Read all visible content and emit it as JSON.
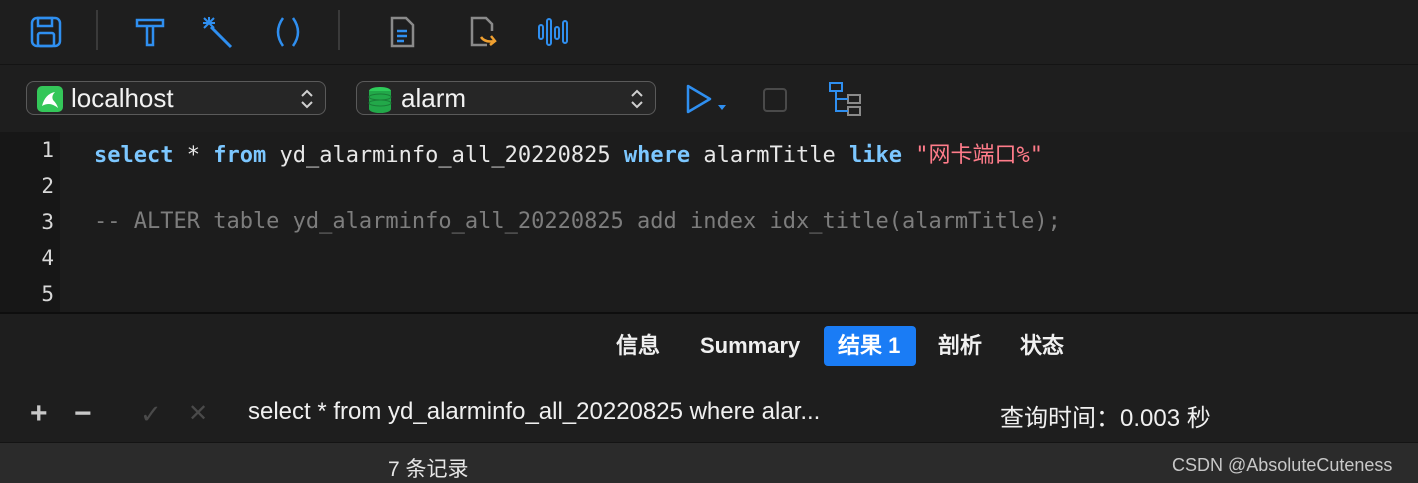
{
  "toolbar": {
    "icons": [
      "save-icon",
      "format-hammer-icon",
      "magic-wand-icon",
      "parentheses-icon",
      "document-icon",
      "export-icon",
      "waveform-icon"
    ]
  },
  "connection": {
    "host": "localhost",
    "database": "alarm"
  },
  "editor": {
    "line_numbers": [
      "1",
      "2",
      "3",
      "4",
      "5"
    ],
    "line1": {
      "kw_select": "select",
      "t1": " * ",
      "kw_from": "from",
      "t2": " yd_alarminfo_all_20220825 ",
      "kw_where": "where",
      "t3": " alarmTitle ",
      "kw_like": "like",
      "t4": " ",
      "str": "\"网卡端口%\""
    },
    "line3_comment": "-- ALTER table yd_alarminfo_all_20220825 add index idx_title(alarmTitle);"
  },
  "tabs": [
    {
      "label": "信息",
      "active": false
    },
    {
      "label": "Summary",
      "active": false
    },
    {
      "label": "结果 1",
      "active": true
    },
    {
      "label": "剖析",
      "active": false
    },
    {
      "label": "状态",
      "active": false
    }
  ],
  "status": {
    "plus": "+",
    "minus": "−",
    "check": "✓",
    "cross": "✕",
    "query_preview": "select * from yd_alarminfo_all_20220825 where alar...",
    "query_time": "查询时间：0.003 秒"
  },
  "footer": {
    "record_count": "7 条记录",
    "watermark": "CSDN @AbsoluteCuteness"
  },
  "colors": {
    "accent": "#1a7cf5",
    "keyword": "#7cc7ff",
    "string": "#ff7c8a",
    "comment": "#7d7d7d",
    "icon_blue": "#2f8ff0"
  }
}
